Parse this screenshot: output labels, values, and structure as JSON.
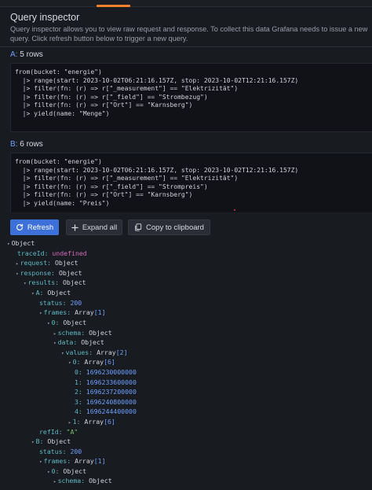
{
  "header": {
    "title": "Query inspector",
    "description": "Query inspector allows you to view raw request and response. To collect this data Grafana needs to issue a new query. Click refresh button below to trigger a new query."
  },
  "queries": [
    {
      "letter": "A:",
      "rows": "5 rows",
      "code": "from(bucket: \"energie\")\n  |> range(start: 2023-10-02T06:21:16.157Z, stop: 2023-10-02T12:21:16.157Z)\n  |> filter(fn: (r) => r[\"_measurement\"] == \"Elektrizität\")\n  |> filter(fn: (r) => r[\"_field\"] == \"Strombezug\")\n  |> filter(fn: (r) => r[\"Ort\"] == \"Karnsberg\")\n  |> yield(name: \"Menge\")"
    },
    {
      "letter": "B:",
      "rows": "6 rows",
      "code": "from(bucket: \"energie\")\n  |> range(start: 2023-10-02T06:21:16.157Z, stop: 2023-10-02T12:21:16.157Z)\n  |> filter(fn: (r) => r[\"_measurement\"] == \"Elektrizität\")\n  |> filter(fn: (r) => r[\"_field\"] == \"Strompreis\")\n  |> filter(fn: (r) => r[\"Ort\"] == \"Karnsberg\")\n  |> yield(name: \"Preis\")"
    }
  ],
  "toolbar": {
    "refresh": "Refresh",
    "expand_all": "Expand all",
    "copy": "Copy to clipboard",
    "accent": "#3d71d9"
  },
  "tree": {
    "root": "Object",
    "traceId_key": "traceId:",
    "traceId_val": "undefined",
    "request_key": "request:",
    "request_val": "Object",
    "response_key": "response:",
    "response_val": "Object",
    "results_key": "results:",
    "results_val": "Object",
    "A_key": "A:",
    "A_val": "Object",
    "A_status_key": "status:",
    "A_status_val": "200",
    "A_frames_key": "frames:",
    "A_frames_val": "Array",
    "A_frames_len": "[1]",
    "A_f0_key": "0:",
    "A_f0_val": "Object",
    "schema_key": "schema:",
    "schema_val": "Object",
    "data_key": "data:",
    "data_val": "Object",
    "values_key": "values:",
    "values_val": "Array",
    "values_len": "[2]",
    "v0_key": "0:",
    "v0_val": "Array",
    "v0_len": "[6]",
    "items": [
      {
        "key": "0:",
        "val": "1696230000000"
      },
      {
        "key": "1:",
        "val": "1696233600000"
      },
      {
        "key": "2:",
        "val": "1696237200000"
      },
      {
        "key": "3:",
        "val": "1696240800000"
      },
      {
        "key": "4:",
        "val": "1696244400000"
      }
    ],
    "v1_key": "1:",
    "v1_val": "Array",
    "v1_len": "[6]",
    "refId_key": "refId:",
    "refId_val": "\"A\"",
    "B_key": "B:",
    "B_val": "Object",
    "B_status_key": "status:",
    "B_status_val": "200",
    "B_frames_key": "frames:",
    "B_frames_val": "Array",
    "B_frames_len": "[1]",
    "B_f0_key": "0:",
    "B_f0_val": "Object",
    "B_schema_key": "schema:",
    "B_schema_val": "Object"
  }
}
